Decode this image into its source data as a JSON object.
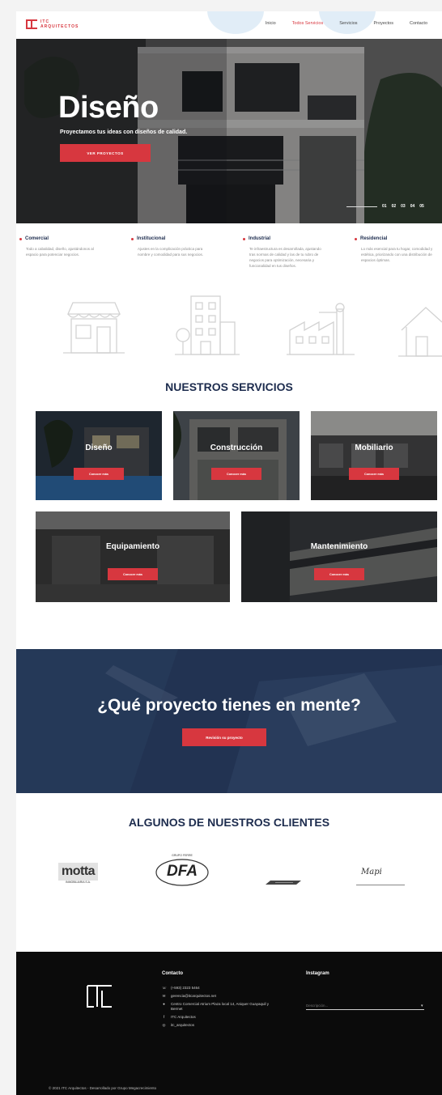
{
  "brand": {
    "logo_text": "ITC\nARQUITECTOS",
    "accent": "#d7373f",
    "navy": "#1d2c4e"
  },
  "nav": [
    {
      "label": "Inicio",
      "active": false
    },
    {
      "label": "Todos Servicios",
      "active": true
    },
    {
      "label": "Servicios",
      "active": false
    },
    {
      "label": "Proyectos",
      "active": false
    },
    {
      "label": "Contacto",
      "active": false
    }
  ],
  "hero": {
    "title": "Diseño",
    "subtitle": "Proyectamos tus ideas con diseños de calidad.",
    "button": "VER PROYECTOS",
    "slides": [
      "01",
      "02",
      "03",
      "04",
      "05"
    ]
  },
  "categories": [
    {
      "title": "Comercial",
      "desc": "Todo a cabalidad, diseño, ajustándonos al espacio para potenciar negocios.",
      "icon": "store-icon"
    },
    {
      "title": "Institucional",
      "desc": "Ajustes en la complicación práctica para nombre y comodidad para sus negocios.",
      "icon": "building-icon"
    },
    {
      "title": "Industrial",
      "desc": "Te infraestructura es desarrollada, ajustando tras normas de calidad y las de tu rubro de negocios para optimización, necesaria y funcionalidad en tus diseños.",
      "icon": "factory-icon"
    },
    {
      "title": "Residencial",
      "desc": "Lo más esencial para tu hogar, comodidad y estética, priorizando con una distribución de espacios óptimas.",
      "icon": "house-icon"
    }
  ],
  "services": {
    "title": "NUESTROS SERVICIOS",
    "button_label": "Conocer más",
    "items": [
      {
        "name": "Diseño"
      },
      {
        "name": "Construcción"
      },
      {
        "name": "Mobiliario"
      },
      {
        "name": "Equipamiento"
      },
      {
        "name": "Mantenimiento"
      }
    ]
  },
  "cta": {
    "title": "¿Qué proyecto tienes en mente?",
    "button": "Revisión su proyecto"
  },
  "clients": {
    "title": "ALGUNOS DE NUESTROS CLIENTES",
    "logos": [
      {
        "name": "motta",
        "caption": "INMOBILIARIA S.A."
      },
      {
        "name": "DFA",
        "caption": "GRUPO FERRE"
      },
      {
        "name": "stripe-logo"
      },
      {
        "name": "Mapi"
      }
    ]
  },
  "footer": {
    "contact_title": "Contacto",
    "contact": [
      {
        "icon": "phone-icon",
        "text": "(+593) 2323 5464"
      },
      {
        "icon": "mail-icon",
        "text": "gerencia@itcarquitectos.net"
      },
      {
        "icon": "pin-icon",
        "text": "Centro Comercial Atrium Plaza local 14, Aniquer Guayaquil y Bermet"
      },
      {
        "icon": "facebook-icon",
        "text": "ITC Arquitectos"
      },
      {
        "icon": "instagram-icon",
        "text": "itc_arquitectos"
      }
    ],
    "instagram_title": "Instagram",
    "instagram_placeholder": "Descripción...",
    "copyright": "© 2021 ITC Arquitectos - Desarrollado por Grupo Megacrecimiento"
  }
}
